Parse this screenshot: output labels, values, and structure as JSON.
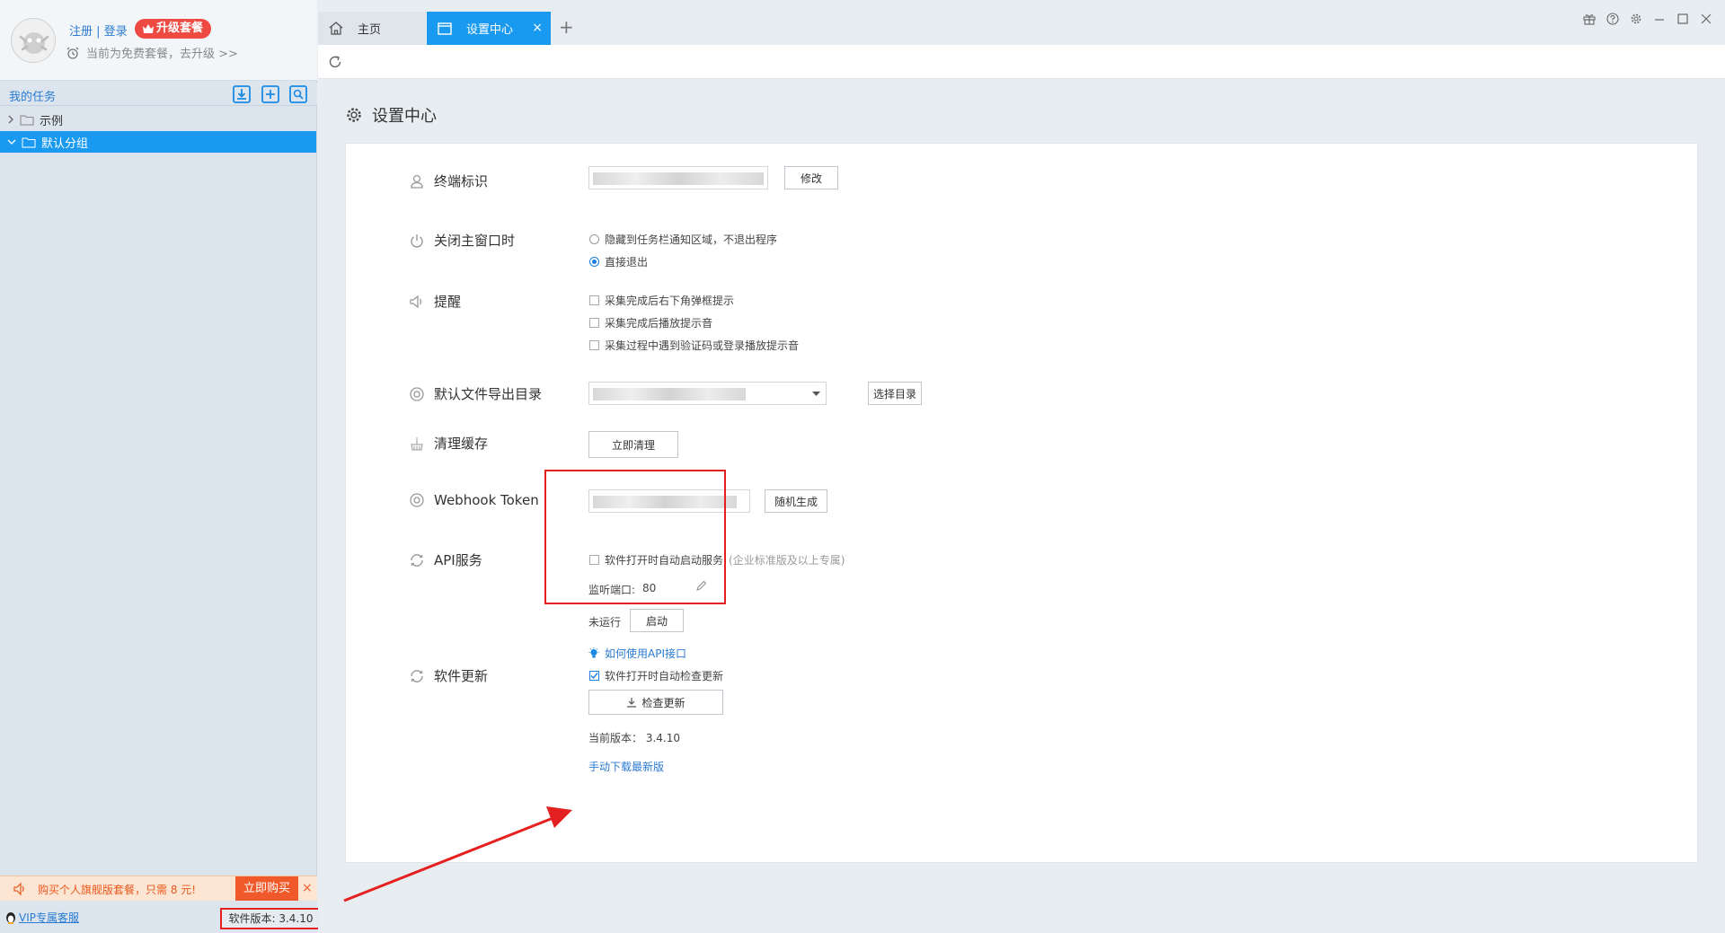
{
  "sidebar": {
    "auth": {
      "register": "注册",
      "separator": " | ",
      "login": "登录"
    },
    "upgrade_label": "升级套餐",
    "free_plan_text": "当前为免费套餐，去升级 >>",
    "task_header": "我的任务",
    "tree": [
      {
        "label": "示例",
        "expanded": false,
        "selected": false
      },
      {
        "label": "默认分组",
        "expanded": true,
        "selected": true
      }
    ],
    "promo": {
      "text": "购买个人旗舰版套餐，只需 8 元!",
      "buy_label": "立即购买",
      "close": "×"
    },
    "vip_support": "VIP专属客服",
    "version_text": "软件版本: 3.4.10"
  },
  "tabs": [
    {
      "label": "主页",
      "active": false
    },
    {
      "label": "设置中心",
      "active": true,
      "close": "×"
    }
  ],
  "tab_add": "+",
  "page": {
    "title": "设置中心",
    "terminal": {
      "label": "终端标识",
      "modify_button": "修改"
    },
    "close_window": {
      "label": "关闭主窗口时",
      "options": [
        {
          "label": "隐藏到任务栏通知区域，不退出程序",
          "selected": false
        },
        {
          "label": "直接退出",
          "selected": true
        }
      ]
    },
    "reminder": {
      "label": "提醒",
      "options": [
        {
          "label": "采集完成后右下角弹框提示",
          "checked": false
        },
        {
          "label": "采集完成后播放提示音",
          "checked": false
        },
        {
          "label": "采集过程中遇到验证码或登录播放提示音",
          "checked": false
        }
      ]
    },
    "export_dir": {
      "label": "默认文件导出目录",
      "choose_button": "选择目录"
    },
    "cache": {
      "label": "清理缓存",
      "clear_button": "立即清理"
    },
    "webhook": {
      "label": "Webhook Token",
      "random_button": "随机生成"
    },
    "api": {
      "label": "API服务",
      "auto_start": "软件打开时自动启动服务",
      "auto_start_note": "(企业标准版及以上专属)",
      "port_label": "监听端口:",
      "port_value": "80",
      "status": "未运行",
      "start_button": "启动",
      "help_link": "如何使用API接口"
    },
    "update": {
      "label": "软件更新",
      "auto_check": "软件打开时自动检查更新",
      "auto_check_checked": true,
      "check_button": "检查更新",
      "current_version_label": "当前版本：",
      "current_version": "3.4.10",
      "manual_download": "手动下载最新版"
    }
  },
  "colors": {
    "accent": "#1a99f0",
    "highlight": "#e52020",
    "link": "#2b7bd1"
  }
}
